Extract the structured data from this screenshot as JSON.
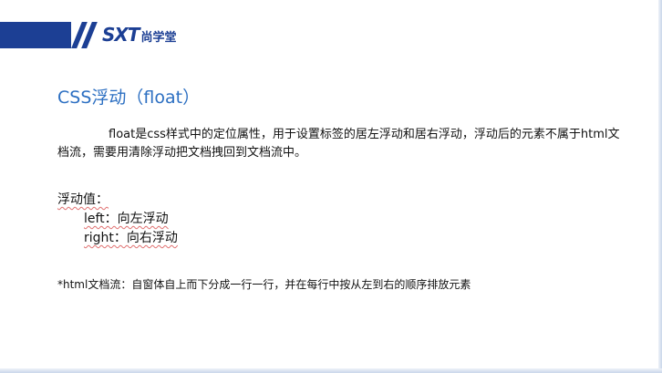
{
  "header": {
    "logo_mark": "SXT",
    "logo_name": "尚学堂"
  },
  "slide": {
    "title": "CSS浮动（float）",
    "paragraph": "float是css样式中的定位属性，用于设置标签的居左浮动和居右浮动，浮动后的元素不属于html文档流，需要用清除浮动把文档拽回到文档流中。",
    "values_heading": "浮动值：",
    "values": [
      "left：向左浮动",
      "right：向右浮动"
    ],
    "footnote": "*html文档流：自窗体自上而下分成一行一行，并在每行中按从左到右的顺序排放元素"
  },
  "colors": {
    "brand": "#1c3f94",
    "title": "#2c6fc2",
    "text": "#111111"
  }
}
